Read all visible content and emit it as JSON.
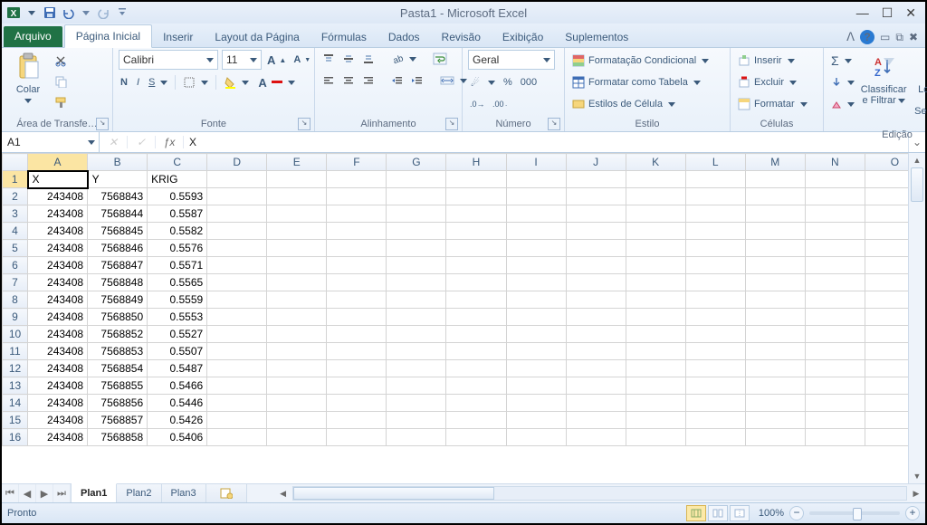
{
  "title": "Pasta1  -  Microsoft Excel",
  "qat": {
    "excel": "X",
    "save": "save",
    "undo": "undo",
    "redo": "redo"
  },
  "tabs": {
    "file": "Arquivo",
    "items": [
      "Página Inicial",
      "Inserir",
      "Layout da Página",
      "Fórmulas",
      "Dados",
      "Revisão",
      "Exibição",
      "Suplementos"
    ],
    "active": 0
  },
  "ribbon": {
    "clipboard": {
      "paste": "Colar",
      "label": "Área de Transfe…"
    },
    "font": {
      "name": "Calibri",
      "size": "11",
      "bold": "N",
      "italic": "I",
      "underline": "S",
      "label": "Fonte",
      "grow": "A",
      "shrink": "A"
    },
    "alignment": {
      "label": "Alinhamento"
    },
    "number": {
      "format": "Geral",
      "label": "Número",
      "pct": "%",
      "thou": "000"
    },
    "styles": {
      "cond": "Formatação Condicional",
      "table": "Formatar como Tabela",
      "cell": "Estilos de Célula",
      "label": "Estilo"
    },
    "cells": {
      "insert": "Inserir",
      "delete": "Excluir",
      "format": "Formatar",
      "label": "Células"
    },
    "editing": {
      "sum": "Σ",
      "sort": "Classificar e Filtrar",
      "find": "Localizar e Selecionar",
      "label": "Edição"
    }
  },
  "namebox": "A1",
  "formula": "X",
  "columns": [
    "A",
    "B",
    "C",
    "D",
    "E",
    "F",
    "G",
    "H",
    "I",
    "J",
    "K",
    "L",
    "M",
    "N",
    "O"
  ],
  "headers": {
    "A": "X",
    "B": "Y",
    "C": "KRIG"
  },
  "rows": [
    {
      "n": 2,
      "A": "243408",
      "B": "7568843",
      "C": "0.5593"
    },
    {
      "n": 3,
      "A": "243408",
      "B": "7568844",
      "C": "0.5587"
    },
    {
      "n": 4,
      "A": "243408",
      "B": "7568845",
      "C": "0.5582"
    },
    {
      "n": 5,
      "A": "243408",
      "B": "7568846",
      "C": "0.5576"
    },
    {
      "n": 6,
      "A": "243408",
      "B": "7568847",
      "C": "0.5571"
    },
    {
      "n": 7,
      "A": "243408",
      "B": "7568848",
      "C": "0.5565"
    },
    {
      "n": 8,
      "A": "243408",
      "B": "7568849",
      "C": "0.5559"
    },
    {
      "n": 9,
      "A": "243408",
      "B": "7568850",
      "C": "0.5553"
    },
    {
      "n": 10,
      "A": "243408",
      "B": "7568852",
      "C": "0.5527"
    },
    {
      "n": 11,
      "A": "243408",
      "B": "7568853",
      "C": "0.5507"
    },
    {
      "n": 12,
      "A": "243408",
      "B": "7568854",
      "C": "0.5487"
    },
    {
      "n": 13,
      "A": "243408",
      "B": "7568855",
      "C": "0.5466"
    },
    {
      "n": 14,
      "A": "243408",
      "B": "7568856",
      "C": "0.5446"
    },
    {
      "n": 15,
      "A": "243408",
      "B": "7568857",
      "C": "0.5426"
    },
    {
      "n": 16,
      "A": "243408",
      "B": "7568858",
      "C": "0.5406"
    }
  ],
  "sheets": [
    "Plan1",
    "Plan2",
    "Plan3"
  ],
  "active_sheet": 0,
  "status": {
    "ready": "Pronto",
    "zoom": "100%"
  }
}
